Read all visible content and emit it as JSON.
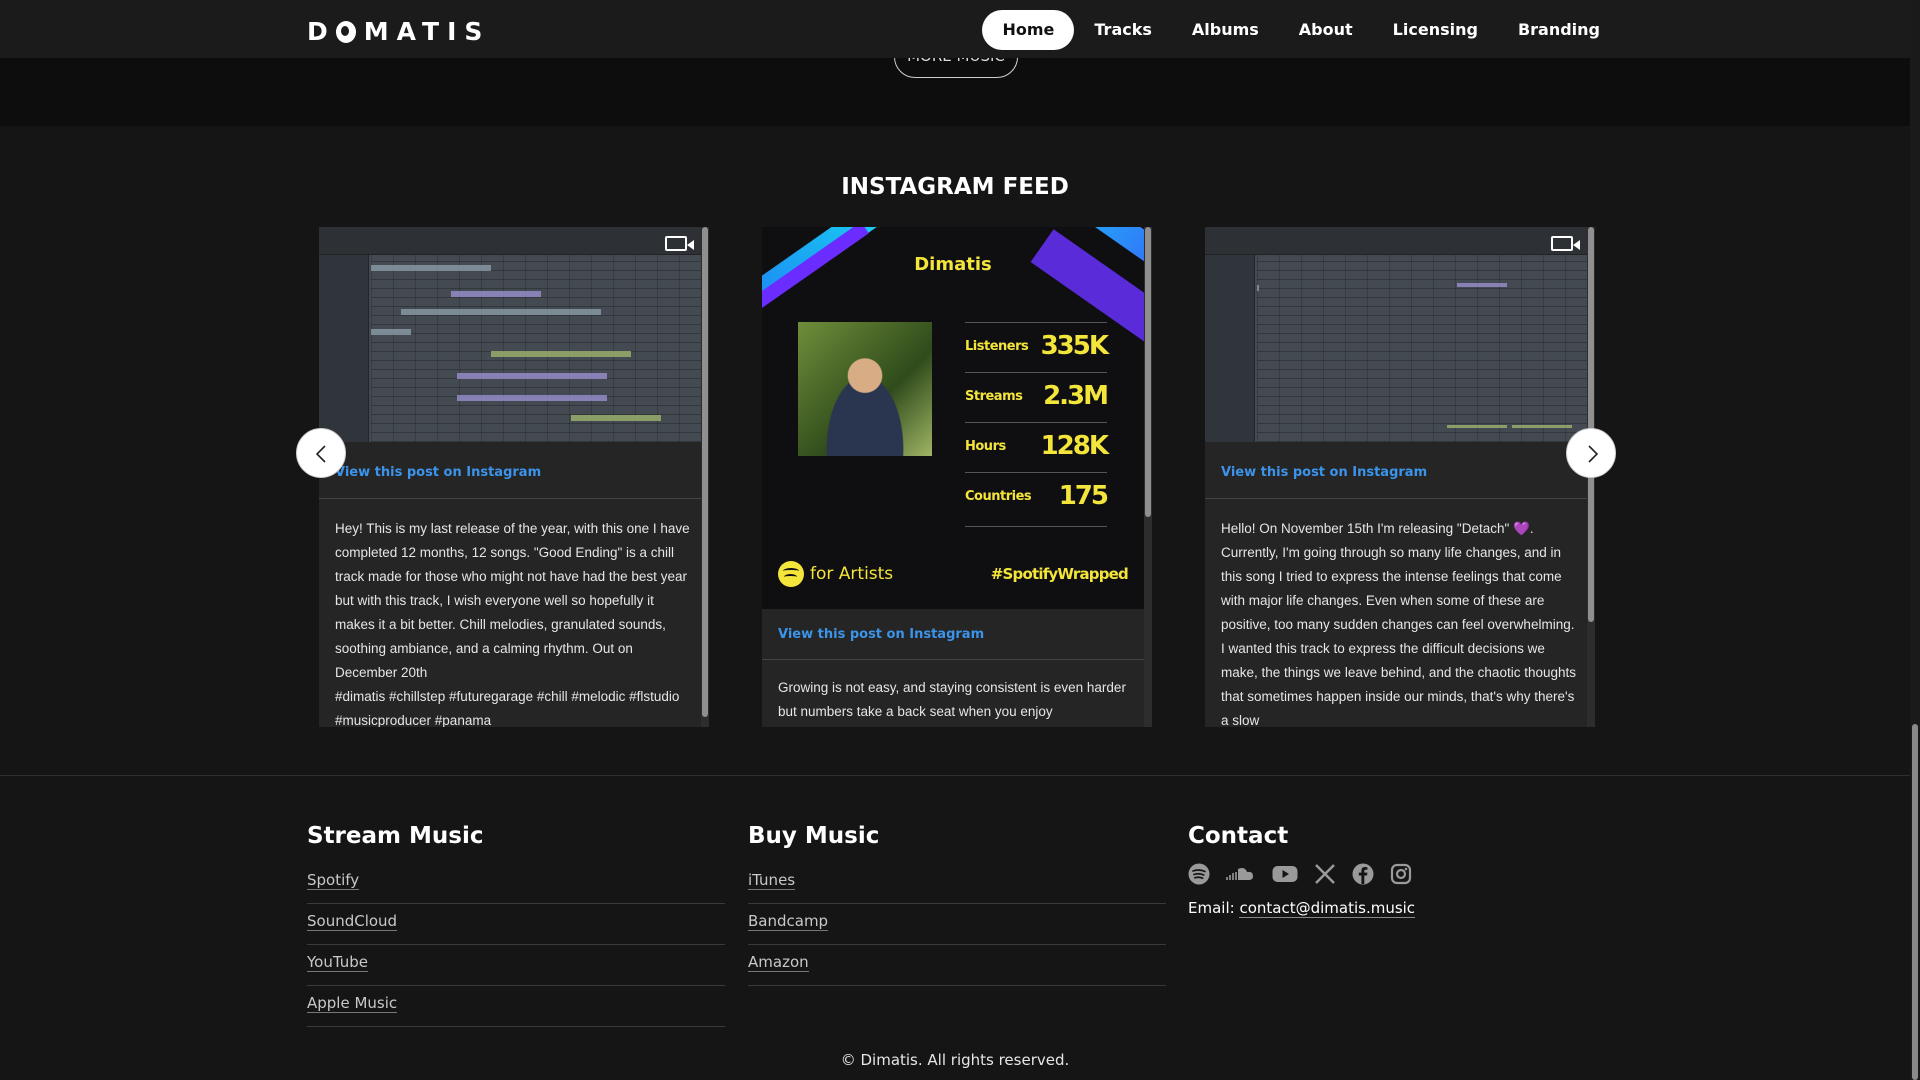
{
  "header": {
    "logo": "DIMATIS",
    "nav": [
      {
        "label": "Home",
        "active": true
      },
      {
        "label": "Tracks"
      },
      {
        "label": "Albums"
      },
      {
        "label": "About"
      },
      {
        "label": "Licensing"
      },
      {
        "label": "Branding"
      }
    ]
  },
  "more_music_label": "MORE MUSIC",
  "instagram": {
    "title": "INSTAGRAM FEED",
    "view_post_label": "View this post on Instagram",
    "posts": [
      {
        "media": "fl-studio-playlist-screenshot",
        "video": true,
        "caption": "Hey! This is my last release of the year, with this one I have completed 12 months, 12 songs. \"Good Ending\" is a chill track made for those who might not have had the best year but with this track, I wish everyone well so hopefully it makes it a bit better. Chill melodies, granulated sounds, soothing ambiance, and a calming rhythm. Out on December 20th",
        "hashtags": "#dimatis #chillstep #futuregarage #chill #melodic #flstudio #musicproducer #panama"
      },
      {
        "media": "spotify-wrapped-card",
        "video": false,
        "spotify": {
          "artist": "Dimatis",
          "stats": [
            {
              "label": "Listeners",
              "value": "335K"
            },
            {
              "label": "Streams",
              "value": "2.3M"
            },
            {
              "label": "Hours",
              "value": "128K"
            },
            {
              "label": "Countries",
              "value": "175"
            }
          ],
          "brand": "for Artists",
          "hashtag": "#SpotifyWrapped"
        },
        "caption": "Growing is not easy, and staying consistent is even harder but numbers take a back seat when you enjoy"
      },
      {
        "media": "fl-studio-playlist-screenshot",
        "video": true,
        "caption": "Hello! On November 15th I'm releasing \"Detach\" 💜. Currently, I'm going through so many life changes, and in this song I tried to express the intense feelings that come with major life changes. Even when some of these are positive, too many sudden changes can feel overwhelming. I wanted this track to express the difficult decisions we make, the things we leave behind, and the chaotic thoughts that sometimes happen inside our minds, that's why there's a slow"
      }
    ]
  },
  "footer": {
    "stream": {
      "title": "Stream Music",
      "links": [
        "Spotify",
        "SoundCloud",
        "YouTube",
        "Apple Music"
      ]
    },
    "buy": {
      "title": "Buy Music",
      "links": [
        "iTunes",
        "Bandcamp",
        "Amazon"
      ]
    },
    "contact": {
      "title": "Contact",
      "icons": [
        "spotify-icon",
        "soundcloud-icon",
        "youtube-icon",
        "x-icon",
        "facebook-icon",
        "instagram-icon"
      ],
      "email_label": "Email:",
      "email": "contact@dimatis.music"
    },
    "copyright": "© Dimatis. All rights reserved."
  },
  "colors": {
    "background": "#151515",
    "link_blue": "#3b94ea",
    "spotify_yellow": "#f4e53a"
  }
}
